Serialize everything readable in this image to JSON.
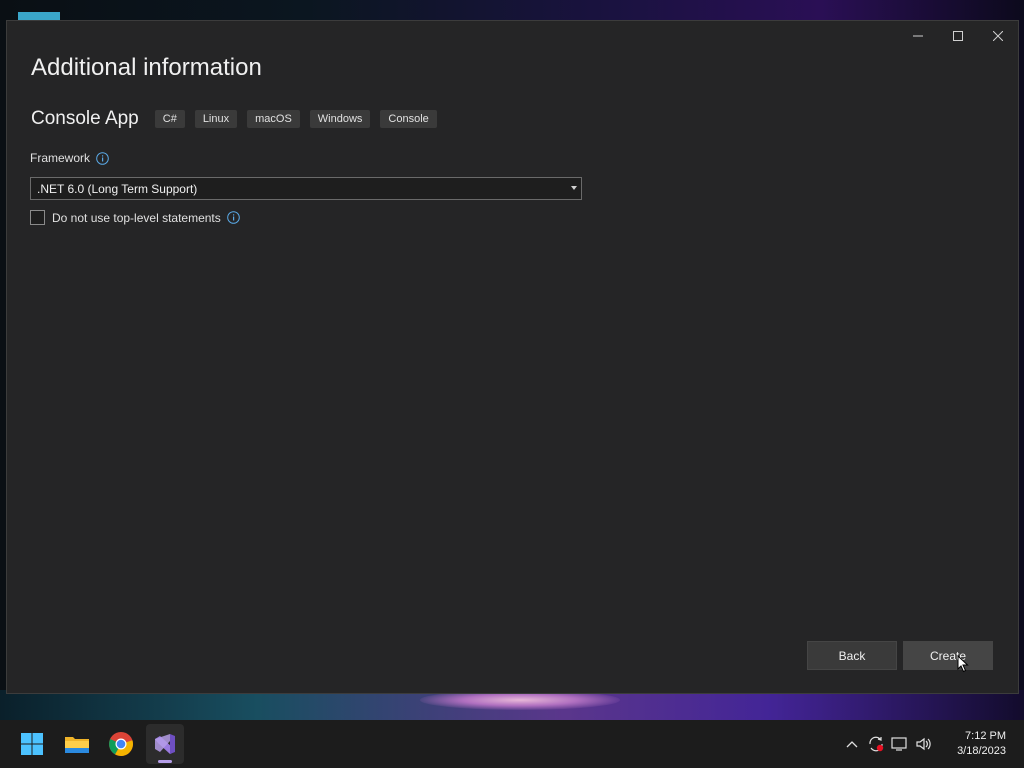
{
  "window": {
    "title": "Additional information",
    "controls": {
      "minimize": "minimize",
      "maximize": "maximize",
      "close": "close"
    }
  },
  "template": {
    "name": "Console App",
    "tags": [
      "C#",
      "Linux",
      "macOS",
      "Windows",
      "Console"
    ]
  },
  "framework": {
    "label": "Framework",
    "selected": ".NET 6.0 (Long Term Support)"
  },
  "top_level_statements": {
    "label": "Do not use top-level statements",
    "checked": false
  },
  "buttons": {
    "back": "Back",
    "create": "Create"
  },
  "taskbar": {
    "icons": [
      "windows-start-icon",
      "file-explorer-icon",
      "chrome-icon",
      "visual-studio-icon"
    ],
    "active_app": "visual-studio-icon",
    "tray_icons": [
      "chevron-up-icon",
      "sync-icon",
      "network-icon",
      "volume-icon"
    ],
    "time": "7:12 PM",
    "date": "3/18/2023"
  },
  "colors": {
    "dialog_bg": "#252526",
    "tag_bg": "#3a3a3a",
    "info_icon": "#5aa9e6",
    "vs_purple": "#b59ee8"
  }
}
